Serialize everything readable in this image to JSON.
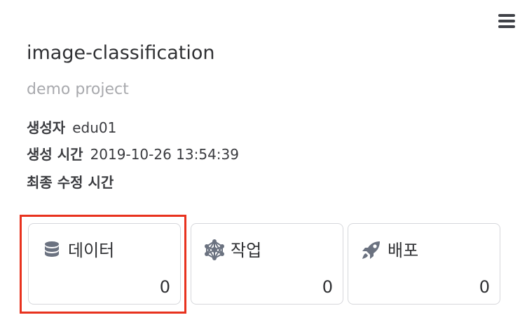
{
  "header": {
    "menu_icon": "hamburger-menu-icon"
  },
  "project": {
    "title": "image-classification",
    "description": "demo project"
  },
  "meta": {
    "creator_label": "생성자",
    "creator_value": "edu01",
    "created_label": "생성 시간",
    "created_value": "2019-10-26 13:54:39",
    "modified_label": "최종 수정 시간",
    "modified_value": ""
  },
  "cards": [
    {
      "label": "데이터",
      "count": "0",
      "icon": "database-icon"
    },
    {
      "label": "작업",
      "count": "0",
      "icon": "network-icon"
    },
    {
      "label": "배포",
      "count": "0",
      "icon": "rocket-icon"
    }
  ],
  "colors": {
    "highlight": "#e8321e",
    "icon": "#6b7280",
    "text": "#2f3033",
    "muted": "#a8a9ad",
    "card_border": "#d6d7db"
  }
}
